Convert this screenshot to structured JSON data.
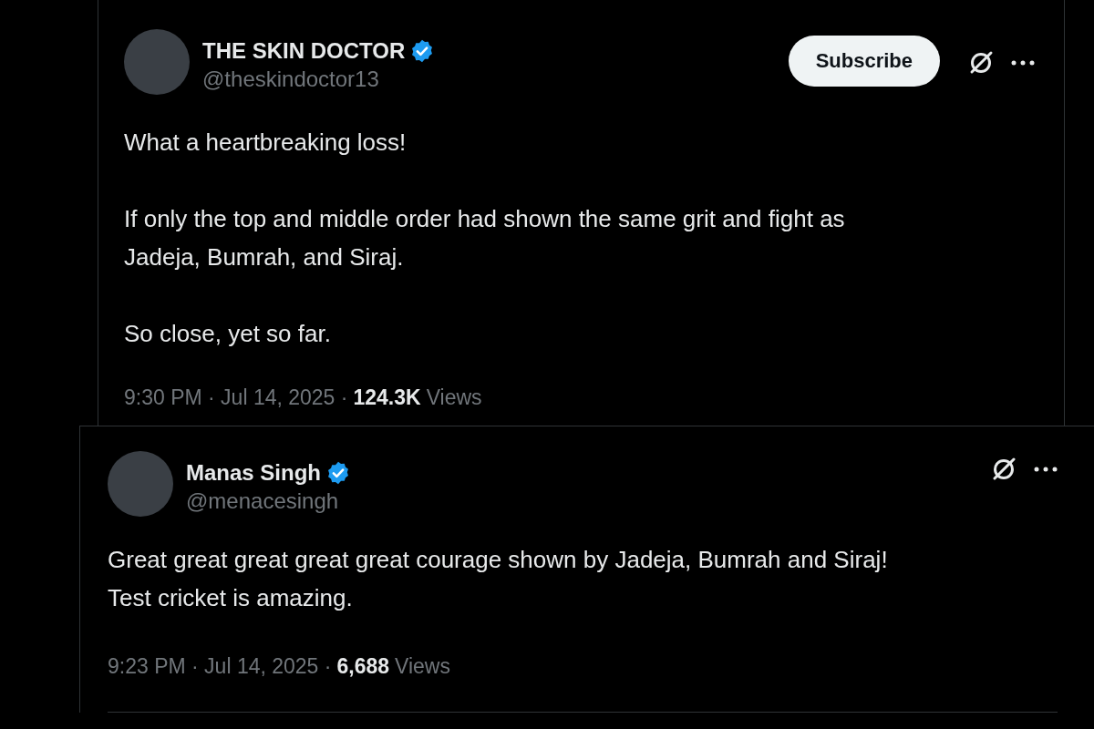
{
  "tweets": [
    {
      "author": {
        "name": "THE SKIN DOCTOR",
        "handle": "@theskindoctor13",
        "verified": true
      },
      "subscribe_button": "Subscribe",
      "paragraphs": [
        [
          "What a heartbreaking loss!"
        ],
        [
          "If only the top and middle order had shown the same grit and fight as",
          "Jadeja, Bumrah, and Siraj."
        ],
        [
          "So close, yet so far."
        ]
      ],
      "timestamp": "9:30 PM · Jul 14, 2025 ·",
      "views_count": "124.3K",
      "views_label": "Views"
    },
    {
      "author": {
        "name": "Manas Singh",
        "handle": "@menacesingh",
        "verified": true
      },
      "paragraphs": [
        [
          "Great great great great great courage shown by Jadeja, Bumrah and Siraj!",
          "Test cricket is amazing."
        ]
      ],
      "timestamp": "9:23 PM · Jul 14, 2025 ·",
      "views_count": "6,688",
      "views_label": "Views"
    }
  ]
}
